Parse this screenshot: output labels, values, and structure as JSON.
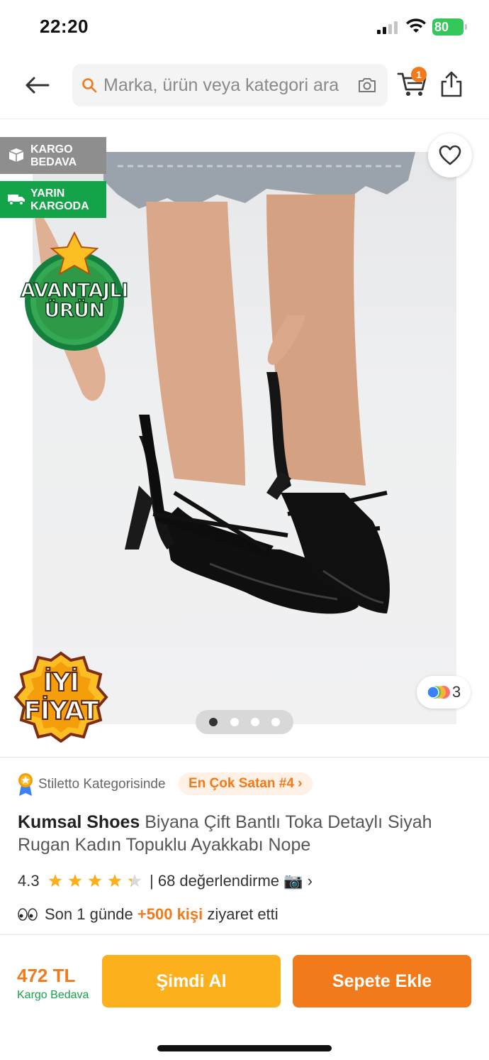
{
  "status_bar": {
    "time": "22:20",
    "battery": "80"
  },
  "header": {
    "search_placeholder": "Marka, ürün veya kategori ara",
    "cart_count": "1"
  },
  "gallery": {
    "badges": {
      "free_shipping": "KARGO\nBEDAVA",
      "next_day": "YARIN\nKARGODA"
    },
    "stickers": {
      "advantage": "AVANTAJLI\nÜRÜN",
      "good_price": "İYİ\nFİYAT"
    },
    "color_count": "3",
    "page_count": 4,
    "active_page": 1
  },
  "product": {
    "bestseller_category": "Stiletto Kategorisinde",
    "bestseller_rank": "En Çok Satan #4 ›",
    "brand": "Kumsal Shoes",
    "name": "Biyana Çift Bantlı Toka Detaylı Siyah Rugan Kadın Topuklu Ayakkabı Nope",
    "rating": "4.3",
    "rating_value": 4.3,
    "rating_count": "| 68 değerlendirme 📷 ›",
    "visitors_prefix": "Son 1 günde",
    "visitors_count": "+500 kişi",
    "visitors_suffix": "ziyaret etti"
  },
  "bottom_bar": {
    "price": "472 TL",
    "shipping": "Kargo Bedava",
    "buy_now_label": "Şimdi Al",
    "add_to_cart_label": "Sepete Ekle"
  },
  "colors": {
    "accent": "#f27a1a",
    "buy_now": "#fbb01c",
    "success": "#15a34a"
  }
}
